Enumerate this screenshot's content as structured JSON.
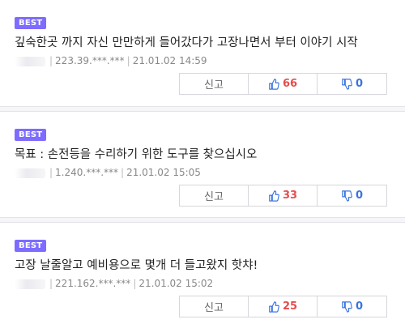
{
  "comments": [
    {
      "badge": "BEST",
      "text": "깊숙한곳 까지 자신 만만하게 들어갔다가 고장나면서 부터 이야기 시작",
      "ip": "223.39.***.***",
      "date": "21.01.02 14:59",
      "report_label": "신고",
      "upvotes": "66",
      "downvotes": "0"
    },
    {
      "badge": "BEST",
      "text": "목표 : 손전등을 수리하기 위한 도구를 찾으십시오",
      "ip": "1.240.***.***",
      "date": "21.01.02 15:05",
      "report_label": "신고",
      "upvotes": "33",
      "downvotes": "0"
    },
    {
      "badge": "BEST",
      "text": "고장 날줄알고 예비용으로 몇개 더 들고왔지 핫챠!",
      "ip": "221.162.***.***",
      "date": "21.01.02 15:02",
      "report_label": "신고",
      "upvotes": "25",
      "downvotes": "0"
    }
  ],
  "colors": {
    "badge": "#7d6cff",
    "upvote": "#e64d4d",
    "downvote": "#3a73e0"
  },
  "icons": {
    "upvote": "thumbs-up-icon",
    "downvote": "thumbs-down-icon"
  }
}
